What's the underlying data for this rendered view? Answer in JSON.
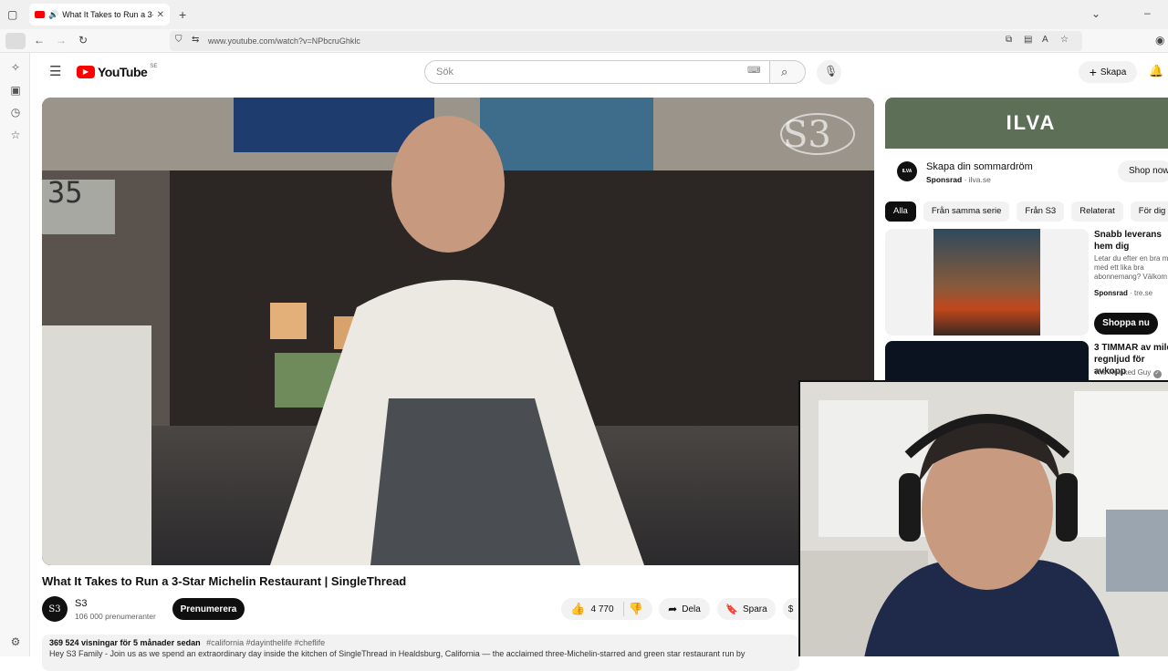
{
  "browser": {
    "tab_title": "What It Takes to Run a 3-St",
    "url": "www.youtube.com/watch?v=NPbcruGhklc"
  },
  "youtube": {
    "logo_text": "YouTube",
    "region": "SE",
    "search_placeholder": "Sök",
    "create_label": "Skapa"
  },
  "video": {
    "watermark": "S3",
    "clock_text": "35",
    "title": "What It Takes to Run a 3-Star Michelin Restaurant | SingleThread",
    "channel_name": "S3",
    "avatar_text": "S3",
    "subscribers": "106 000 prenumeranter",
    "subscribe_label": "Prenumerera",
    "likes": "4 770",
    "share_label": "Dela",
    "save_label": "Spara",
    "views_date": "369 524 visningar  för 5 månader sedan",
    "hashtags": "#california #dayinthelife #cheflife",
    "description_line": "Hey S3 Family - Join us as we spend an extraordinary day inside the kitchen of SingleThread in Healdsburg, California — the acclaimed three-Michelin-starred and green star restaurant run by"
  },
  "ad": {
    "brand": "ILVA",
    "logo_small": "ILVA",
    "title": "Skapa din sommardröm",
    "sponsor": "Sponsrad",
    "domain": "ilva.se",
    "cta": "Shop now"
  },
  "chips": [
    "Alla",
    "Från samma serie",
    "Från S3",
    "Relaterat",
    "För dig"
  ],
  "recommendations": [
    {
      "title": "Snabb leverans hem dig",
      "desc": "Letar du efter en bra m med ett lika bra abonnemang? Välkom",
      "sponsor": "Sponsrad",
      "domain": "tre.se",
      "cta": "Shoppa nu"
    },
    {
      "title": "3 TIMMAR av mild regnljud för avkopp",
      "channel": "The Relaxed Guy"
    }
  ],
  "colors": {
    "yt_red": "#ff0000",
    "ad_green": "#5e6f58"
  }
}
